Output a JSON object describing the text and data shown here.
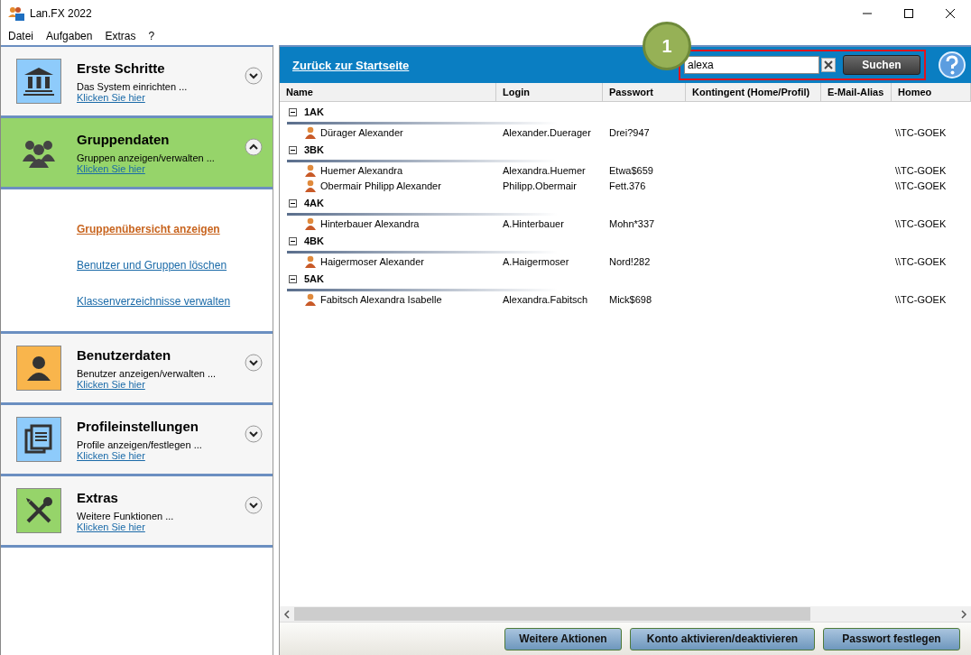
{
  "window": {
    "title": "Lan.FX 2022"
  },
  "menu": [
    {
      "label": "Datei"
    },
    {
      "label": "Aufgaben"
    },
    {
      "label": "Extras"
    },
    {
      "label": "?"
    }
  ],
  "sidebar": {
    "sections": [
      {
        "title": "Erste Schritte",
        "subtitle": "Das System einrichten ...",
        "link": "Klicken Sie hier",
        "kind": "bank",
        "color": "#8ecbfb",
        "expanded": false
      },
      {
        "title": "Gruppendaten",
        "subtitle": "Gruppen anzeigen/verwalten ...",
        "link": "Klicken Sie hier",
        "kind": "group",
        "expanded": true,
        "links": [
          {
            "label": "Gruppenübersicht anzeigen",
            "selected": true
          },
          {
            "label": "Benutzer und Gruppen löschen",
            "selected": false
          },
          {
            "label": "Klassenverzeichnisse verwalten",
            "selected": false
          }
        ]
      },
      {
        "title": "Benutzerdaten",
        "subtitle": "Benutzer anzeigen/verwalten ...",
        "link": "Klicken Sie hier",
        "kind": "user",
        "color": "#f9b54c",
        "expanded": false
      },
      {
        "title": "Profileinstellungen",
        "subtitle": "Profile anzeigen/festlegen ...",
        "link": "Klicken Sie hier",
        "kind": "document",
        "color": "#8ecbfb",
        "expanded": false
      },
      {
        "title": "Extras",
        "subtitle": "Weitere Funktionen ...",
        "link": "Klicken Sie hier",
        "kind": "tools",
        "color": "#96d46a",
        "expanded": false
      }
    ]
  },
  "header": {
    "back_link": "Zurück zur Startseite",
    "search": {
      "value": "alexa"
    },
    "search_button": "Suchen"
  },
  "callout": {
    "label": "1"
  },
  "table": {
    "columns": [
      "Name",
      "Login",
      "Passwort",
      "Kontingent (Home/Profil)",
      "E-Mail-Alias",
      "Homeo"
    ],
    "groups": [
      {
        "name": "1AK",
        "expanded": true,
        "rows": [
          {
            "name": "Dürager Alexander",
            "login": "Alexander.Duerager",
            "password": "Drei?947",
            "home": "\\\\TC-GOEK"
          }
        ]
      },
      {
        "name": "3BK",
        "expanded": true,
        "rows": [
          {
            "name": "Huemer Alexandra",
            "login": "Alexandra.Huemer",
            "password": "Etwa$659",
            "home": "\\\\TC-GOEK"
          },
          {
            "name": "Obermair Philipp Alexander",
            "login": "Philipp.Obermair",
            "password": "Fett.376",
            "home": "\\\\TC-GOEK"
          }
        ]
      },
      {
        "name": "4AK",
        "expanded": true,
        "rows": [
          {
            "name": "Hinterbauer Alexandra",
            "login": "A.Hinterbauer",
            "password": "Mohn*337",
            "home": "\\\\TC-GOEK"
          }
        ]
      },
      {
        "name": "4BK",
        "expanded": true,
        "rows": [
          {
            "name": "Haigermoser Alexander",
            "login": "A.Haigermoser",
            "password": "Nord!282",
            "home": "\\\\TC-GOEK"
          }
        ]
      },
      {
        "name": "5AK",
        "expanded": true,
        "rows": [
          {
            "name": "Fabitsch Alexandra Isabelle",
            "login": "Alexandra.Fabitsch",
            "password": "Mick$698",
            "home": "\\\\TC-GOEK"
          }
        ]
      }
    ]
  },
  "actions": [
    "Weitere Aktionen",
    "Konto aktivieren/deaktivieren",
    "Passwort festlegen"
  ]
}
